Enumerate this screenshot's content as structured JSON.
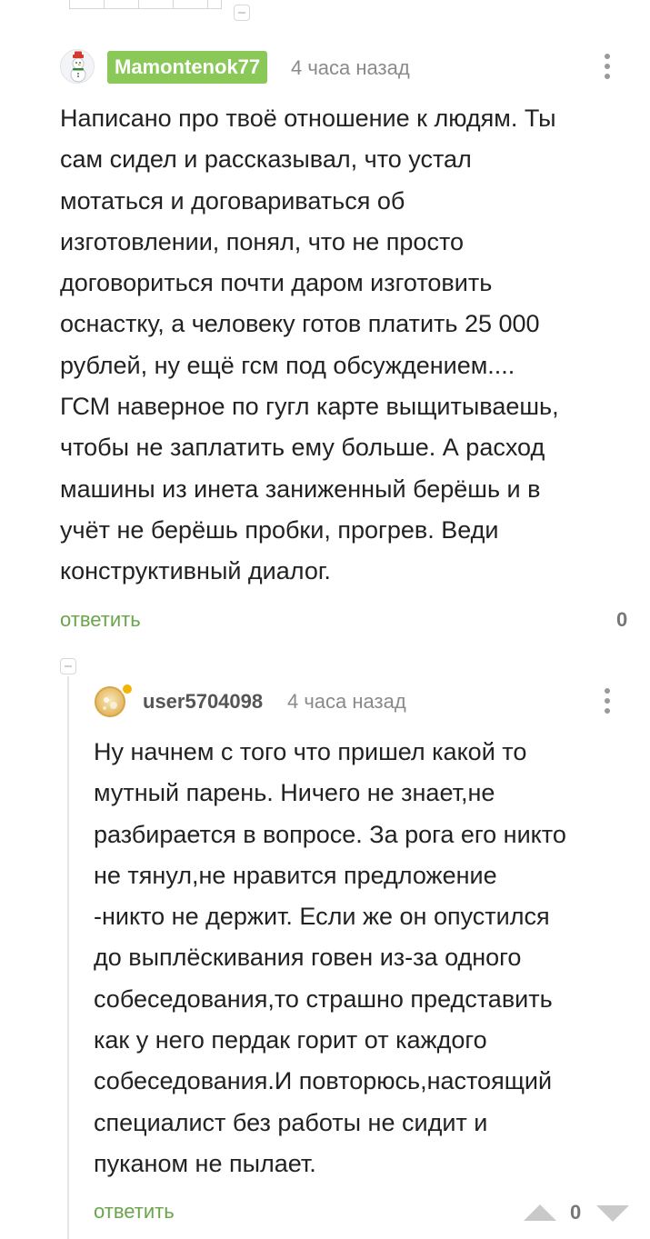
{
  "comments": [
    {
      "author": "Mamontenok77",
      "time": "4 часа назад",
      "text_lines": [
        "Написано про твоё отношение к людям. Ты",
        "сам сидел и рассказывал, что устал",
        "мотаться и договариваться об",
        "изготовлении, понял, что не просто",
        "договориться почти даром изготовить",
        "оснастку, а человеку готов платить 25 000",
        "рублей, ну ещё гсм под обсуждением....",
        "ГСМ наверное по гугл карте выщитываешь,",
        "чтобы не заплатить ему больше. А расход",
        "машины из инета заниженный берёшь и в",
        "учёт не берёшь пробки, прогрев. Веди",
        "конструктивный диалог."
      ],
      "reply_label": "ответить",
      "rating": "0",
      "badge_color": "#8ac858",
      "avatar_icon": "snowman-avatar-icon"
    },
    {
      "author": "user5704098",
      "time": "4 часа назад",
      "text_lines": [
        "Ну начнем с того что пришел какой то",
        "мутный парень. Ничего не знает,не",
        "разбирается в вопросе. За рога его никто",
        "не тянул,не нравится предложение",
        "-никто не держит. Если же он опустился",
        "до выплёскивания говен из-за одного",
        "собеседования,то страшно представить",
        "как у него пердак горит от каждого",
        "собеседования.И повторюсь,настоящий",
        "специалист без работы не сидит и",
        "пуканом не пылает."
      ],
      "reply_label": "ответить",
      "rating": "0",
      "avatar_icon": "default-avatar-icon"
    }
  ],
  "colors": {
    "accent_green": "#6aa54b",
    "online_dot": "#f5b400",
    "muted": "#8a8a8a"
  }
}
